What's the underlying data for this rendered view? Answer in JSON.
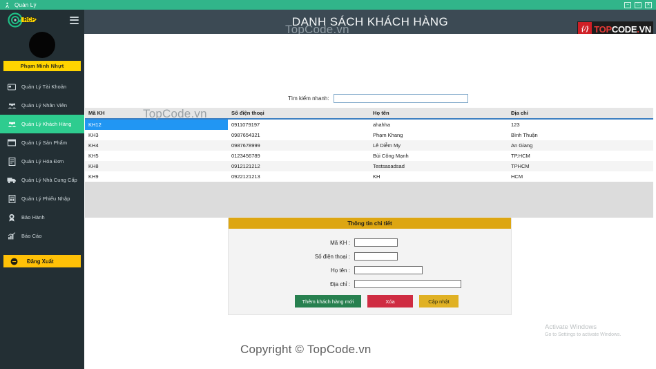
{
  "window": {
    "title": "Quản Lý",
    "app_icon": "person-icon",
    "controls": [
      {
        "name": "minimize",
        "glyph": "–"
      },
      {
        "name": "maximize",
        "glyph": "□"
      },
      {
        "name": "close",
        "glyph": "✕"
      }
    ]
  },
  "sidebar": {
    "brand": "RCP",
    "menu_toggle": "hamburger-icon",
    "user_name": "Phạm Minh Nhựt",
    "items": [
      {
        "label": "Quản Lý Tài Khoản",
        "icon": "credit-card-icon",
        "active": false
      },
      {
        "label": "Quản Lý Nhân Viên",
        "icon": "users-icon",
        "active": false
      },
      {
        "label": "Quản Lý Khách Hàng",
        "icon": "users-icon",
        "active": true
      },
      {
        "label": "Quản Lý Sản Phẩm",
        "icon": "box-icon",
        "active": false
      },
      {
        "label": "Quản Lý Hóa Đơn",
        "icon": "invoice-icon",
        "active": false
      },
      {
        "label": "Quản Lý Nhà Cung Cấp",
        "icon": "truck-icon",
        "active": false
      },
      {
        "label": "Quản Lý Phiếu Nhập",
        "icon": "document-icon",
        "active": false
      },
      {
        "label": "Bảo Hành",
        "icon": "shield-icon",
        "active": false
      },
      {
        "label": "Báo Cáo",
        "icon": "chart-icon",
        "active": false
      }
    ],
    "logout": {
      "label": "Đăng Xuất",
      "icon": "power-icon"
    }
  },
  "header": {
    "title": "DANH SÁCH KHÁCH HÀNG",
    "watermark": "TopCode.vn",
    "logo": {
      "mark": "{/}",
      "part1": "TOP",
      "part2": "CODE",
      "part3": ".",
      "part4": "VN"
    }
  },
  "search": {
    "label": "Tìm kiếm nhanh:",
    "value": "",
    "placeholder": ""
  },
  "table": {
    "columns": [
      "Mã KH",
      "Số điện thoại",
      "Họ tên",
      "Địa chỉ"
    ],
    "selected_index": 0,
    "watermark": "TopCode.vn",
    "rows": [
      {
        "ma_kh": "KH12",
        "sdt": "0911079197",
        "ho_ten": "ahahha",
        "dia_chi": "123"
      },
      {
        "ma_kh": "KH3",
        "sdt": "0987654321",
        "ho_ten": "Phạm Khang",
        "dia_chi": "Bình Thuận"
      },
      {
        "ma_kh": "KH4",
        "sdt": "0987678999",
        "ho_ten": "Lê Diễm My",
        "dia_chi": "An Giang"
      },
      {
        "ma_kh": "KH5",
        "sdt": "0123456789",
        "ho_ten": "Bùi Công Mạnh",
        "dia_chi": "TP.HCM"
      },
      {
        "ma_kh": "KH8",
        "sdt": "0912121212",
        "ho_ten": "Testsasadsad",
        "dia_chi": "TPHCM"
      },
      {
        "ma_kh": "KH9",
        "sdt": "0922121213",
        "ho_ten": "KH",
        "dia_chi": "HCM"
      }
    ]
  },
  "detail": {
    "title": "Thông tin chi tiết",
    "fields": [
      {
        "label": "Mã KH :",
        "value": ""
      },
      {
        "label": "Số điện thoại :",
        "value": ""
      },
      {
        "label": "Họ tên :",
        "value": ""
      },
      {
        "label": "Địa chỉ :",
        "value": ""
      }
    ],
    "buttons": {
      "add": "Thêm khách hàng mới",
      "delete": "Xóa",
      "update": "Cập nhật"
    }
  },
  "footer": {
    "activate_title": "Activate Windows",
    "activate_sub": "Go to Settings to activate Windows.",
    "copyright": "Copyright © TopCode.vn"
  },
  "colors": {
    "titlebar": "#31b58a",
    "sidebar": "#232f34",
    "accent_green": "#2ecc8f",
    "accent_yellow": "#ffd400",
    "header": "#3c4a54",
    "select_blue": "#2196f3",
    "panel_gold": "#dda612",
    "btn_green": "#27804f",
    "btn_red": "#cf2c42",
    "btn_yellow": "#e0b124"
  }
}
